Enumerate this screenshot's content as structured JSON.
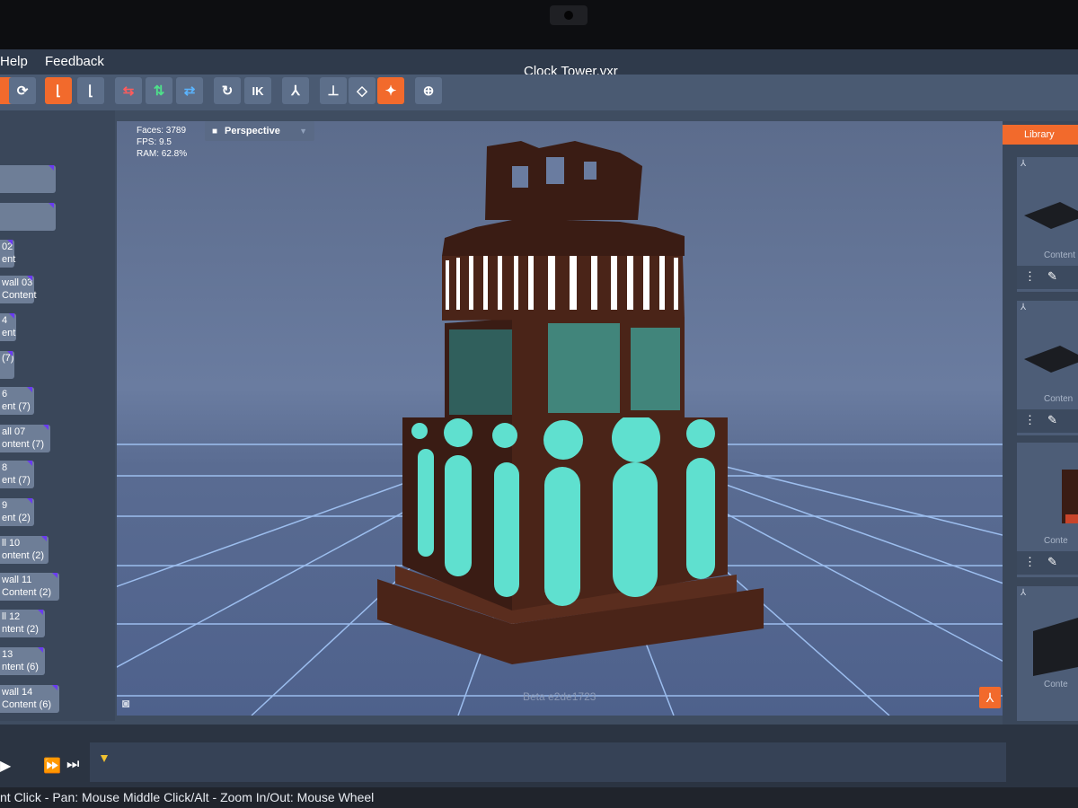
{
  "menu": {
    "items": [
      "Help",
      "Feedback"
    ]
  },
  "window": {
    "title": "Clock Tower.vxr"
  },
  "toolbar": {
    "ik_label": "IK"
  },
  "outline": {
    "items": [
      {
        "line1": "",
        "line2": ""
      },
      {
        "line1": "",
        "line2": ""
      },
      {
        "line1": "02",
        "line2": "ent"
      },
      {
        "line1": "wall 03",
        "line2": "Content"
      },
      {
        "line1": "4",
        "line2": "ent"
      },
      {
        "line1": "",
        "line2": "(7)"
      },
      {
        "line1": "6",
        "line2": "ent (7)"
      },
      {
        "line1": "all 07",
        "line2": "ontent (7)"
      },
      {
        "line1": "8",
        "line2": "ent (7)"
      },
      {
        "line1": "9",
        "line2": "ent (2)"
      },
      {
        "line1": "ll 10",
        "line2": "ontent (2)"
      },
      {
        "line1": "wall 11",
        "line2": "Content (2)"
      },
      {
        "line1": "ll 12",
        "line2": "ntent (2)"
      },
      {
        "line1": "13",
        "line2": "ntent (6)"
      },
      {
        "line1": "wall 14",
        "line2": "Content (6)"
      }
    ]
  },
  "viewport": {
    "stats": {
      "faces": "Faces: 3789",
      "fps": "FPS: 9.5",
      "ram": "RAM: 62.8%"
    },
    "view_mode": "Perspective",
    "build": "Beta e2de1723"
  },
  "library": {
    "tab_label": "Library",
    "cards": [
      {
        "caption": "Content"
      },
      {
        "caption": "Conten"
      },
      {
        "caption": "Conte"
      },
      {
        "caption": "Conte"
      }
    ]
  },
  "status": {
    "hint": "nt Click - Pan: Mouse Middle Click/Alt - Zoom In/Out: Mouse Wheel"
  },
  "colors": {
    "accent": "#f26a2c",
    "glass": "#5fe0cf",
    "wood": "#4a2418",
    "grid": "#9fc8ff"
  }
}
